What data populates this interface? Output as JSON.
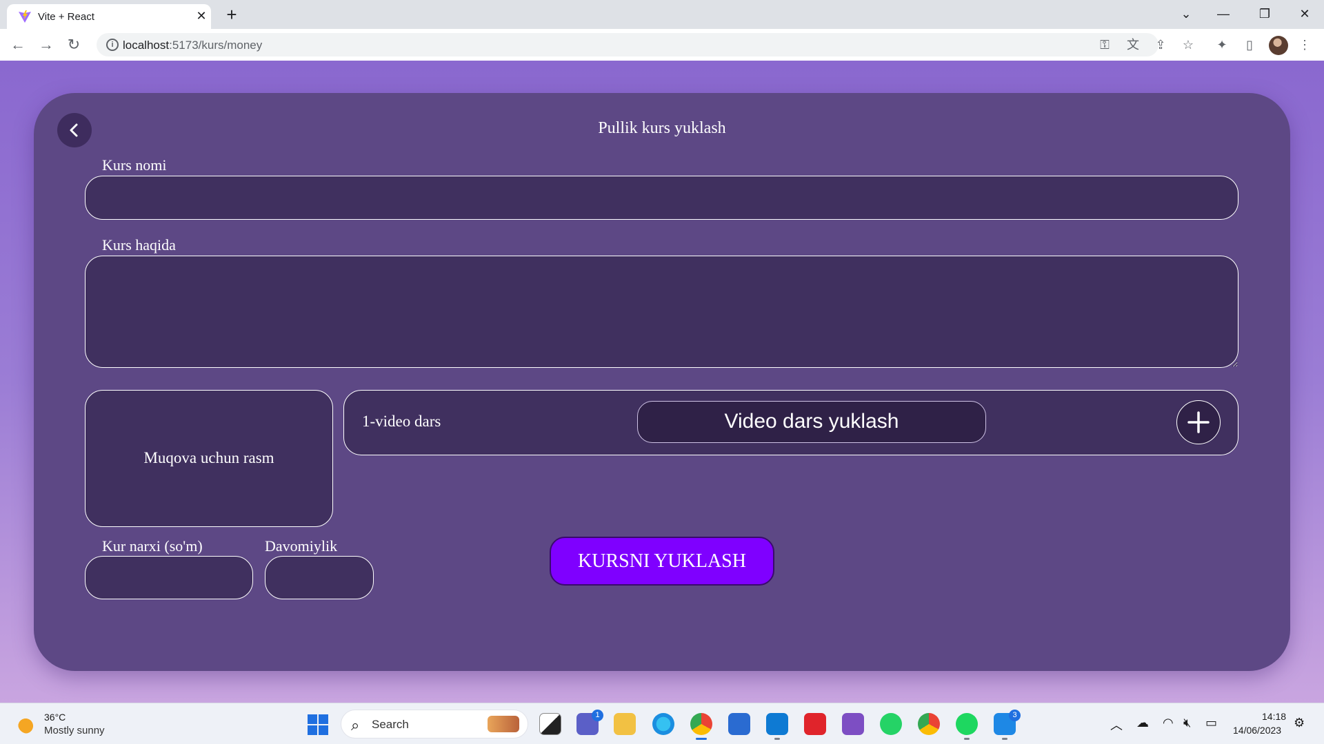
{
  "browser": {
    "tab_title": "Vite + React",
    "tab_close": "✕",
    "new_tab": "+",
    "url_host": "localhost",
    "url_path": ":5173/kurs/money"
  },
  "form": {
    "title": "Pullik kurs yuklash",
    "course_name_label": "Kurs nomi",
    "course_name_value": "",
    "about_label": "Kurs haqida",
    "about_value": "",
    "cover_label": "Muqova uchun rasm",
    "video_label": "1-video dars",
    "video_upload_label": "Video dars yuklash",
    "price_label": "Kur narxi (so'm)",
    "price_value": "",
    "duration_label": "Davomiylik",
    "duration_value": "",
    "submit_label": "KURSNI YUKLASH"
  },
  "taskbar": {
    "weather_temp": "36°C",
    "weather_desc": "Mostly sunny",
    "search_placeholder": "Search",
    "teams_badge": "1",
    "app_badge": "3",
    "time": "14:18",
    "date": "14/06/2023"
  },
  "colors": {
    "page_bg": "#8a68cf",
    "card_bg": "#5d4885",
    "field_bg": "#40305f",
    "submit_bg": "#7f00ff"
  }
}
